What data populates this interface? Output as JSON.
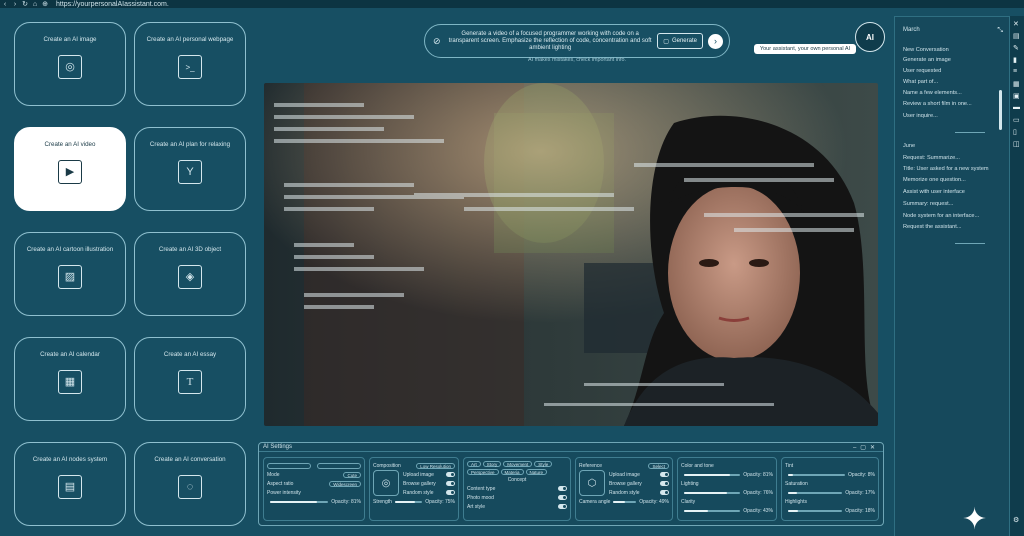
{
  "browser": {
    "url": "https://yourpersonalAIassistant.com."
  },
  "tiles": [
    {
      "label": "Create an AI image",
      "icon": "image-icon",
      "glyph": "◎"
    },
    {
      "label": "Create an AI personal webpage",
      "icon": "terminal-icon",
      "glyph": ">_"
    },
    {
      "label": "Create an AI video",
      "icon": "play-icon",
      "glyph": "▶"
    },
    {
      "label": "Create an AI plan for relaxing",
      "icon": "cocktail-icon",
      "glyph": "Y"
    },
    {
      "label": "Create an AI cartoon illustration",
      "icon": "illustration-icon",
      "glyph": "▨"
    },
    {
      "label": "Create an AI 3D object",
      "icon": "cube-icon",
      "glyph": "◈"
    },
    {
      "label": "Create an AI calendar",
      "icon": "calendar-icon",
      "glyph": "▦"
    },
    {
      "label": "Create an AI essay",
      "icon": "text-icon",
      "glyph": "T"
    },
    {
      "label": "Create an AI nodes system",
      "icon": "nodes-icon",
      "glyph": "▤"
    },
    {
      "label": "Create an AI conversation",
      "icon": "chat-icon",
      "glyph": "◌"
    }
  ],
  "prompt": {
    "text": "Generate a video of a focused programmer working with code on a transparent screen. Emphasize the reflection of code, concentration and soft ambient lighting",
    "generate_label": "Generate",
    "disclaimer": "AI makes mistakes, check important info."
  },
  "brand": {
    "logo_text": "AI",
    "tooltip": "Your assistant, your own personal AI"
  },
  "settings": {
    "title": "AI Settings",
    "mode_label": "Mode",
    "mode_value": "Cute",
    "aspect_label": "Aspect ratio",
    "aspect_value": "Widescreen",
    "intensity_label": "Power intensity",
    "intensity_value": "Opacity: 81%",
    "intensity_fraction": 0.81,
    "composition_label": "Composition",
    "composition_value": "Low Resolution",
    "upload_image": "Upload image",
    "browse_gallery": "Browse gallery",
    "random_style": "Random style",
    "strength_label": "Strength",
    "strength_value": "Opacity: 75%",
    "strength_fraction": 0.75,
    "art_tags": [
      "Art",
      "Story",
      "Movement",
      "Style",
      "Perspective",
      "Materia",
      "Nature"
    ],
    "concept_label": "Concept",
    "content_type": "Content type",
    "photo_mood": "Photo mood",
    "art_style": "Art style",
    "reference_label": "Reference",
    "reference_value": "Select",
    "reference_upload": "Upload image",
    "reference_browse": "Browse gallery",
    "reference_random": "Random style",
    "camera_label": "Camera angle",
    "camera_value": "Opacity: 49%",
    "camera_fraction": 0.49,
    "sliders_a": [
      {
        "label": "Color and tone",
        "value": "Opacity: 81%",
        "fraction": 0.81
      },
      {
        "label": "Lighting",
        "value": "Opacity: 76%",
        "fraction": 0.76
      },
      {
        "label": "Clarity",
        "value": "Opacity: 43%",
        "fraction": 0.43
      }
    ],
    "sliders_b": [
      {
        "label": "Tint",
        "value": "Opacity: 8%",
        "fraction": 0.08
      },
      {
        "label": "Saturation",
        "value": "Opacity: 17%",
        "fraction": 0.17
      },
      {
        "label": "Highlights",
        "value": "Opacity: 18%",
        "fraction": 0.18
      }
    ]
  },
  "history": {
    "month1": "March",
    "month1_items": [
      "New Conversation",
      "Generate an image",
      "User requested",
      "What part of...",
      "Name a few elements...",
      "Review a short film in one...",
      "User inquire..."
    ],
    "month2": "June",
    "month2_items": [
      "Request: Summarize...",
      "Title: User asked for a new system",
      "Memorize one question...",
      "Assist with user interface",
      "Summary: request...",
      "Node system for an interface...",
      "Request the assistant..."
    ]
  },
  "colors": {
    "background": "#174f63",
    "panel": "#16495c",
    "accent": "#8fc0cf",
    "active_tile": "#ffffff"
  }
}
